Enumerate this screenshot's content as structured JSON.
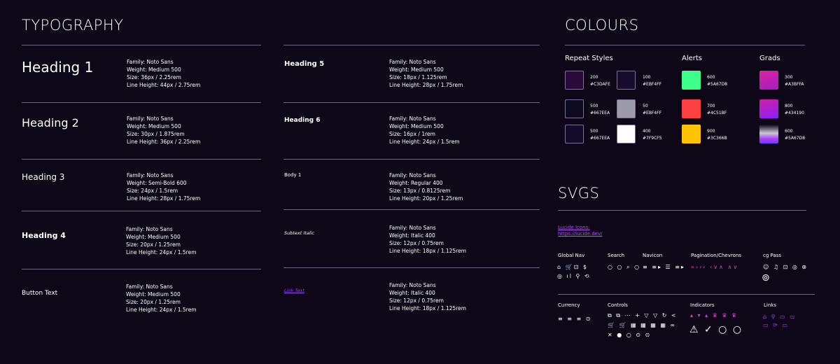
{
  "typography": {
    "title": "TYPOGRAPHY",
    "left": [
      {
        "label": "Heading 1",
        "spec": "Family: Noto Sans\nWeight: Medium 500\nSize: 36px / 2.25rem\nLine Height: 44px / 2.75rem"
      },
      {
        "label": "Heading 2",
        "spec": "Family: Noto Sans\nWeight: Medium 500\nSize: 30px / 1.875rem\nLine Height: 36px / 2.25rem"
      },
      {
        "label": "Heading 3",
        "spec": "Family: Noto Sans\nWeight: Semi-Bold 600\nSize: 24px / 1.5rem\nLine Height: 28px / 1.75rem"
      },
      {
        "label": "Heading 4",
        "spec": "Family: Noto Sans\nWeight: Medium 500\nSize: 20px / 1.25rem\nLine Height: 24px / 1.5rem"
      },
      {
        "label": "Button Text",
        "spec": "Family: Noto Sans\nWeight: Medium 500\nSize: 20px / 1.25rem\nLine Height: 24px / 1.5rem"
      }
    ],
    "right": [
      {
        "label": "Heading 5",
        "spec": "Family: Noto Sans\nWeight: Medium 500\nSize: 18px / 1.125rem\nLine Height: 28px / 1.75rem"
      },
      {
        "label": "Heading 6",
        "spec": "Family: Noto Sans\nWeight: Medium 500\nSize: 16px / 1rem\nLine Height: 24px / 1.5rem"
      },
      {
        "label": "Body 1",
        "spec": "Family: Noto Sans\nWeight: Regular 400\nSize: 13px / 0.8125rem\nLine Height: 20px / 1.25rem"
      },
      {
        "label": "Subtext Italic",
        "spec": "Family: Noto Sans\nWeight: Italic 400\nSize: 12px / 0.75rem\nLine Height: 18px / 1.125rem"
      },
      {
        "label": "Link Text",
        "spec": "Family: Noto Sans\nWeight: Italic 400\nSize: 12px / 0.75rem\nLine Height: 18px / 1.125rem"
      }
    ]
  },
  "colours": {
    "title": "COLOURS",
    "groups": {
      "repeat": "Repeat Styles",
      "alerts": "Alerts",
      "grads": "Grads"
    },
    "swatches": [
      {
        "label": "200\n#C3DAFE",
        "color": "#2a0a3a"
      },
      {
        "label": "100\n#EBF4FF",
        "color": "#170b2e"
      },
      {
        "label": "500\n#667EEA",
        "color": "#0c0a1e"
      },
      {
        "label": "50\n#EBF4FF",
        "color": "#9a9aa8"
      },
      {
        "label": "500\n#667EEA",
        "color": "#140a2c"
      },
      {
        "label": "400\n#7F9CF5",
        "color": "#ffffff"
      },
      {
        "label": "600\n#5A67D8",
        "color": "#3dff8a"
      },
      {
        "label": "700\n#4C51BF",
        "color": "#ff4040"
      },
      {
        "label": "900\n#3C366B",
        "color": "#ffc300"
      },
      {
        "label": "300\n#A3BFFA",
        "color": "#d020a0"
      },
      {
        "label": "800\n#434190",
        "color": "#b020e0"
      },
      {
        "label": "600\n#5A67D8",
        "color": "#7a3aff"
      }
    ]
  },
  "svgs": {
    "title": "SVGS",
    "lucide_label": "Lucide Icons:",
    "lucide_link": "https://lucide.dev/",
    "categories": {
      "global_nav": "Global Nav",
      "search": "Search",
      "navicon": "Navicon",
      "pagination": "Pagination/Chevrons",
      "cg_pass": "cg Pass",
      "currency": "Currency",
      "controls": "Controls",
      "indicators": "Indicators",
      "links": "Links"
    },
    "icons": {
      "global_nav_row1": "⌂ 🛒⊡ $",
      "global_nav_row2": "◎ ıl ⚲ ⟲",
      "search_row": "○ ○ ⌕ ○",
      "navicon_row": "≡ ≡▸ ☰ ≡▸",
      "pagination_row": "»‹›‹ ‹∨∧ ∧∨",
      "cgpass_row": "☺ ♫ ⊡ ◎ ⊗",
      "camera": "⊚",
      "currency_row": "≡ ≡ ≡ ⊙",
      "controls_row1": "⧉ ⧉ ⋯ + ▽ ▽ ↻ <",
      "controls_row2": "🛒 🛒 ▦ ▦ ▦ ▦ ∞",
      "controls_row3": "✕ ● ○ ⊙ ⊙",
      "indicators_row1": "▴ ▾ ▴ ♛ ♛ ♛",
      "indicators_row2": "⚠ ✓ ○ ○",
      "links_row1": "⌂ ⚲ ▭ ▭",
      "links_row2": "▭ ⟳ ▭"
    }
  },
  "colors": {
    "background": "#0d0717",
    "accent_purple": "#b040ff",
    "accent_pink": "#e040d0",
    "divider": "#6b6480"
  }
}
